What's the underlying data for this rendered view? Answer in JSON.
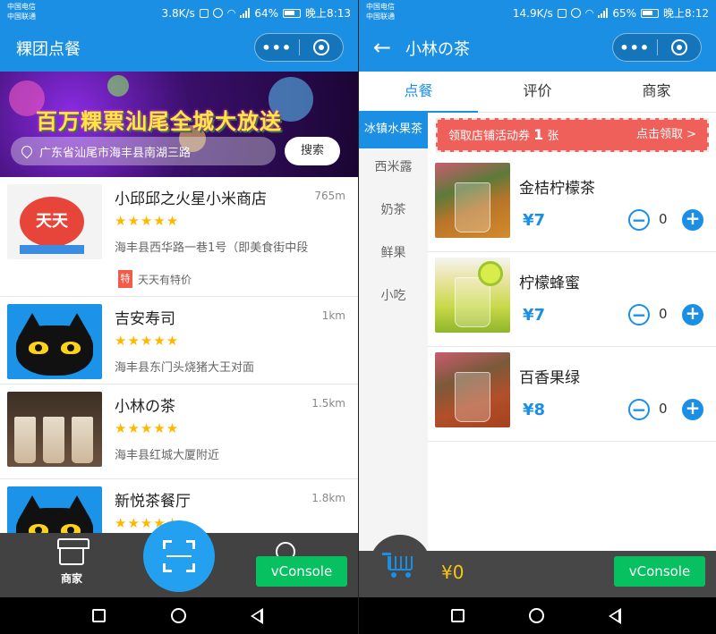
{
  "left": {
    "status": {
      "carrier1": "中国电信",
      "carrier2": "中国联通",
      "speed": "3.8K/s",
      "battery": "64%",
      "time": "晚上8:13"
    },
    "title": "粿团点餐",
    "banner": {
      "headline": "百万粿票汕尾全城大放送",
      "address": "广东省汕尾市海丰县南湖三路",
      "search_label": "搜索"
    },
    "shops": [
      {
        "name": "小邱邱之火星小米商店",
        "distance": "765m",
        "stars": "★★★★★",
        "address": "海丰县西华路一巷1号（即美食街中段",
        "promo_badge": "特",
        "promo_text": "天天有特价",
        "logo_text": "天天"
      },
      {
        "name": "吉安寿司",
        "distance": "1km",
        "stars": "★★★★★",
        "address": "海丰县东门头烧猪大王对面"
      },
      {
        "name": "小林の茶",
        "distance": "1.5km",
        "stars": "★★★★★",
        "address": "海丰县红城大厦附近"
      },
      {
        "name": "新悦茶餐厅",
        "distance": "1.8km",
        "stars": "★★★★★"
      }
    ],
    "tabbar": {
      "home_label": "商家",
      "vconsole_label": "vConsole"
    }
  },
  "right": {
    "status": {
      "carrier1": "中国电信",
      "carrier2": "中国联通",
      "speed": "14.9K/s",
      "battery": "65%",
      "time": "晚上8:12"
    },
    "title": "小林の茶",
    "tabs": [
      "点餐",
      "评价",
      "商家"
    ],
    "categories": [
      "冰镇水果茶",
      "西米露",
      "奶茶",
      "鲜果",
      "小吃"
    ],
    "coupon": {
      "prefix": "领取店铺活动券",
      "count": "1",
      "suffix": "张",
      "claim": "点击领取 >"
    },
    "items": [
      {
        "name": "金桔柠檬茶",
        "price": "¥7",
        "qty": "0"
      },
      {
        "name": "柠檬蜂蜜",
        "price": "¥7",
        "qty": "0"
      },
      {
        "name": "百香果绿",
        "price": "¥8",
        "qty": "0"
      }
    ],
    "cart_total": "¥0",
    "vconsole_label": "vConsole"
  },
  "colors": {
    "primary": "#1a8fe3",
    "coupon": "#f0605a",
    "star": "#ffb800",
    "vconsole": "#07c160",
    "tabbar": "#424242"
  },
  "icons": [
    "location-pin-icon",
    "more-dots-icon",
    "target-icon",
    "store-icon",
    "scan-icon",
    "search-icon",
    "back-arrow-icon",
    "minus-icon",
    "plus-icon",
    "cart-icon"
  ]
}
